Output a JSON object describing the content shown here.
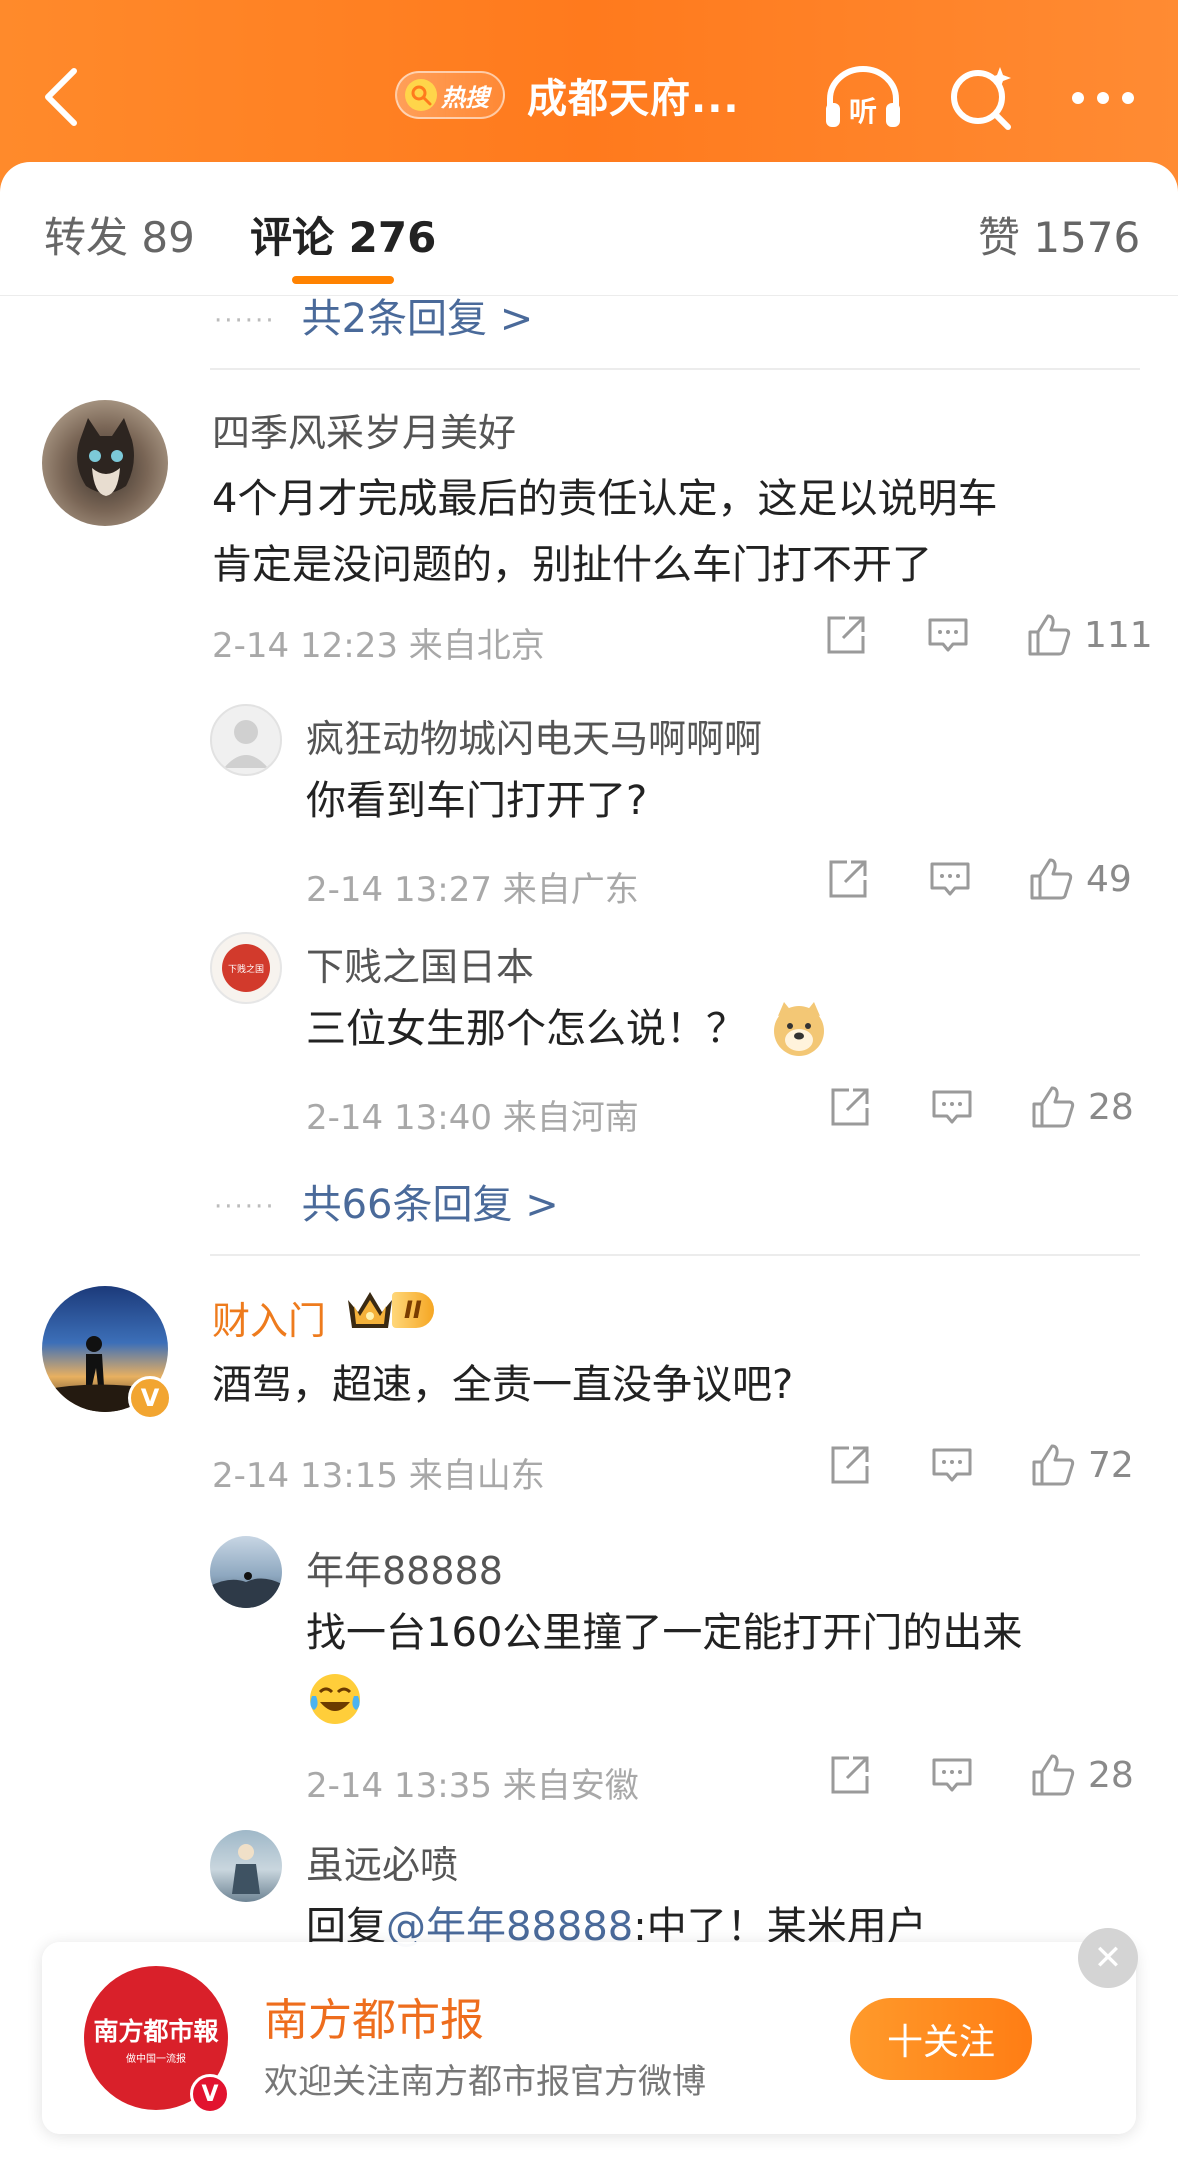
{
  "header": {
    "hot_badge": "热搜",
    "title": "成都天府...",
    "icons": [
      "back-icon",
      "listen-icon",
      "search-sparkle-icon",
      "more-icon"
    ],
    "listen_label": "听",
    "colors": {
      "bar": "#ff7a1d",
      "accent": "#ff8200"
    }
  },
  "tabs": {
    "repost": "转发 89",
    "comments": "评论 276",
    "likes": "赞 1576"
  },
  "top_reply_more": "共2条回复 >",
  "comments": [
    {
      "username": "四季风采岁月美好",
      "text_line1": "4个月才完成最后的责任认定，这足以说明车",
      "text_line2": "肯定是没问题的，别扯什么车门打不开了",
      "meta": "2-14 12:23  来自北京",
      "likes": "111",
      "replies": [
        {
          "username": "疯狂动物城闪电天马啊啊啊",
          "text": "你看到车门打开了?",
          "meta": "2-14 13:27  来自广东",
          "likes": "49"
        },
        {
          "username": "下贱之国日本",
          "avatar_text": "下贱之国",
          "text": "三位女生那个怎么说！？",
          "meta": "2-14 13:40  来自河南",
          "likes": "28"
        }
      ],
      "more": "共66条回复 >"
    },
    {
      "username": "财入门",
      "badge_level": "II",
      "text": "酒驾，超速，全责一直没争议吧?",
      "meta": "2-14 13:15  来自山东",
      "likes": "72",
      "replies": [
        {
          "username": "年年88888",
          "text": "找一台160公里撞了一定能打开门的出来",
          "meta": "2-14 13:35  来自安徽",
          "likes": "28"
        },
        {
          "username": "虽远必喷",
          "text_prefix": "回复",
          "mention": "@年年88888",
          "text_suffix": ":中了！某米用户"
        }
      ]
    }
  ],
  "follow_card": {
    "logo_text": "南方都市報",
    "logo_subtext": "做中国一流报",
    "name": "南方都市报",
    "desc": "欢迎关注南方都市报官方微博",
    "button": "十关注",
    "close": "✕"
  }
}
